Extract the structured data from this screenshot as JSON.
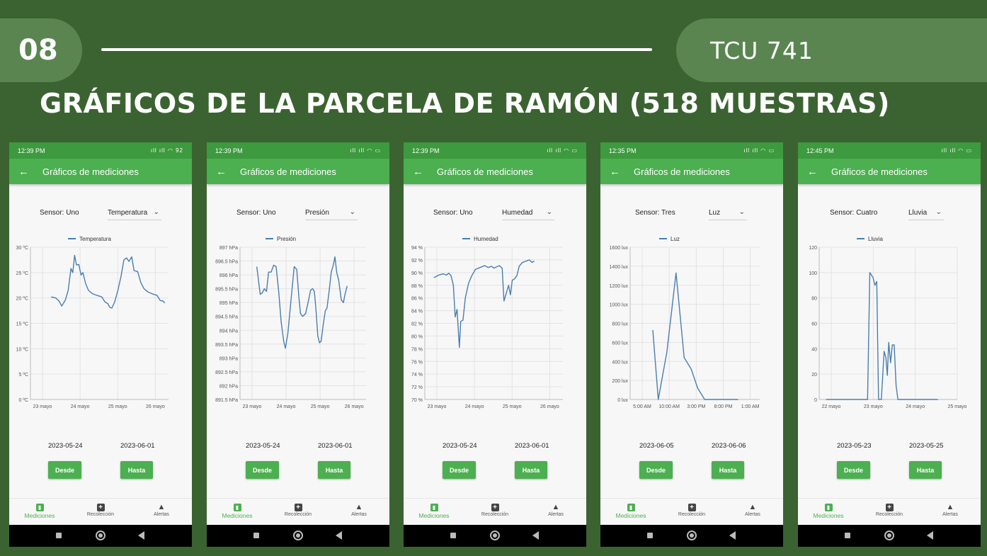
{
  "slide": {
    "number": "08",
    "course": "TCU 741",
    "title": "GRÁFICOS DE LA PARCELA DE RAMÓN (518 MUESTRAS)"
  },
  "colors": {
    "background": "#3b6331",
    "pill": "#5a8550",
    "app_green": "#4caf50",
    "status_green": "#3d9a3e",
    "line": "#4a7eb0"
  },
  "phones": [
    {
      "status_time": "12:39 PM",
      "status_icons": "ıll ıll ◠ 92",
      "app_title": "Gráficos de mediciones",
      "sensor_label": "Sensor: Uno",
      "selected": "Temperatura",
      "date_from": "2023-05-24",
      "date_to": "2023-06-01",
      "btn_from": "Desde",
      "btn_to": "Hasta",
      "nav": [
        "Mediciones",
        "Recolección",
        "Alertas"
      ],
      "chart_data": {
        "type": "line",
        "legend": "Temperatura",
        "y_unit": "°C",
        "y_ticks": [
          "0 ºC",
          "5 ºC",
          "10 ºC",
          "15 ºC",
          "20 ºC",
          "25 ºC",
          "30 ºC"
        ],
        "ylim": [
          0,
          30
        ],
        "x_ticks": [
          "23 mayo",
          "24 mayo",
          "25 mayo",
          "26 mayo"
        ],
        "xlim": [
          23.0,
          26.0
        ],
        "points": [
          [
            23.45,
            20.2
          ],
          [
            23.55,
            20.0
          ],
          [
            23.62,
            19.4
          ],
          [
            23.68,
            18.4
          ],
          [
            23.76,
            19.6
          ],
          [
            23.82,
            21.5
          ],
          [
            23.88,
            25.8
          ],
          [
            23.92,
            25.0
          ],
          [
            23.96,
            28.4
          ],
          [
            24.0,
            26.5
          ],
          [
            24.05,
            26.6
          ],
          [
            24.1,
            24.5
          ],
          [
            24.14,
            25.0
          ],
          [
            24.2,
            22.8
          ],
          [
            24.26,
            21.5
          ],
          [
            24.35,
            20.8
          ],
          [
            24.45,
            20.5
          ],
          [
            24.55,
            20.2
          ],
          [
            24.62,
            19.2
          ],
          [
            24.68,
            18.9
          ],
          [
            24.72,
            18.2
          ],
          [
            24.77,
            18.0
          ],
          [
            24.83,
            19.2
          ],
          [
            24.9,
            21.5
          ],
          [
            24.97,
            24.3
          ],
          [
            25.03,
            27.5
          ],
          [
            25.09,
            27.9
          ],
          [
            25.14,
            27.2
          ],
          [
            25.2,
            28.1
          ],
          [
            25.25,
            25.4
          ],
          [
            25.33,
            25.2
          ],
          [
            25.4,
            23.0
          ],
          [
            25.47,
            21.8
          ],
          [
            25.55,
            21.2
          ],
          [
            25.65,
            20.8
          ],
          [
            25.75,
            20.5
          ],
          [
            25.82,
            19.5
          ],
          [
            25.88,
            19.4
          ],
          [
            25.92,
            19.0
          ]
        ]
      }
    },
    {
      "status_time": "12:39 PM",
      "status_icons": "ıll ıll ◠ ▭",
      "app_title": "Gráficos de mediciones",
      "sensor_label": "Sensor: Uno",
      "selected": "Presión",
      "date_from": "2023-05-24",
      "date_to": "2023-06-01",
      "btn_from": "Desde",
      "btn_to": "Hasta",
      "nav": [
        "Mediciones",
        "Recolección",
        "Alertas"
      ],
      "chart_data": {
        "type": "line",
        "legend": "Presión",
        "y_unit": "hPa",
        "y_ticks": [
          "891.5 hPa",
          "892 hPa",
          "892.5 hPa",
          "893 hPa",
          "893.5 hPa",
          "894 hPa",
          "894.5 hPa",
          "895 hPa",
          "895.5 hPa",
          "896 hPa",
          "896.5 hPa",
          "897 hPa"
        ],
        "ylim": [
          891.5,
          897
        ],
        "x_ticks": [
          "23 mayo",
          "24 mayo",
          "25 mayo",
          "26 mayo"
        ],
        "xlim": [
          23.0,
          26.0
        ],
        "points": [
          [
            23.4,
            896.3
          ],
          [
            23.48,
            895.3
          ],
          [
            23.53,
            895.35
          ],
          [
            23.58,
            895.5
          ],
          [
            23.63,
            895.4
          ],
          [
            23.68,
            896.1
          ],
          [
            23.74,
            896.1
          ],
          [
            23.8,
            896.35
          ],
          [
            23.86,
            896.3
          ],
          [
            23.92,
            895.4
          ],
          [
            23.98,
            894.3
          ],
          [
            24.04,
            893.6
          ],
          [
            24.08,
            893.35
          ],
          [
            24.14,
            893.9
          ],
          [
            24.22,
            895.2
          ],
          [
            24.29,
            896.3
          ],
          [
            24.35,
            896.2
          ],
          [
            24.4,
            895.2
          ],
          [
            24.44,
            894.6
          ],
          [
            24.49,
            894.5
          ],
          [
            24.56,
            894.6
          ],
          [
            24.62,
            895.0
          ],
          [
            24.68,
            895.45
          ],
          [
            24.73,
            895.5
          ],
          [
            24.77,
            895.4
          ],
          [
            24.81,
            894.7
          ],
          [
            24.85,
            893.8
          ],
          [
            24.89,
            893.55
          ],
          [
            24.93,
            893.6
          ],
          [
            24.98,
            894.2
          ],
          [
            25.03,
            894.7
          ],
          [
            25.07,
            894.8
          ],
          [
            25.12,
            895.4
          ],
          [
            25.17,
            896.1
          ],
          [
            25.22,
            896.35
          ],
          [
            25.26,
            896.65
          ],
          [
            25.3,
            896.1
          ],
          [
            25.35,
            895.8
          ],
          [
            25.41,
            895.1
          ],
          [
            25.46,
            895.0
          ],
          [
            25.5,
            895.3
          ],
          [
            25.55,
            895.6
          ]
        ]
      }
    },
    {
      "status_time": "12:39 PM",
      "status_icons": "ıll ıll ◠ ▭",
      "app_title": "Gráficos de mediciones",
      "sensor_label": "Sensor: Uno",
      "selected": "Humedad",
      "date_from": "2023-05-24",
      "date_to": "2023-06-01",
      "btn_from": "Desde",
      "btn_to": "Hasta",
      "nav": [
        "Mediciones",
        "Recolección",
        "Alertas"
      ],
      "chart_data": {
        "type": "line",
        "legend": "Humedad",
        "y_unit": "%",
        "y_ticks": [
          "70 %",
          "72 %",
          "74 %",
          "76 %",
          "78 %",
          "80 %",
          "82 %",
          "84 %",
          "86 %",
          "88 %",
          "90 %",
          "92 %",
          "94 %"
        ],
        "ylim": [
          70,
          94
        ],
        "x_ticks": [
          "23 mayo",
          "24 mayo",
          "25 mayo",
          "26 mayo"
        ],
        "xlim": [
          23.0,
          26.0
        ],
        "points": [
          [
            23.2,
            89.2
          ],
          [
            23.3,
            89.6
          ],
          [
            23.4,
            89.8
          ],
          [
            23.47,
            89.6
          ],
          [
            23.52,
            89.9
          ],
          [
            23.57,
            89.5
          ],
          [
            23.62,
            88.0
          ],
          [
            23.66,
            83.0
          ],
          [
            23.7,
            84.2
          ],
          [
            23.75,
            78.2
          ],
          [
            23.78,
            82.3
          ],
          [
            23.83,
            82.5
          ],
          [
            23.88,
            86.0
          ],
          [
            23.95,
            88.3
          ],
          [
            24.02,
            89.5
          ],
          [
            24.1,
            90.5
          ],
          [
            24.2,
            90.8
          ],
          [
            24.3,
            91.1
          ],
          [
            24.38,
            90.8
          ],
          [
            24.45,
            91.0
          ],
          [
            24.5,
            90.7
          ],
          [
            24.56,
            90.9
          ],
          [
            24.62,
            91.1
          ],
          [
            24.68,
            90.7
          ],
          [
            24.72,
            85.5
          ],
          [
            24.78,
            87.0
          ],
          [
            24.82,
            88.0
          ],
          [
            24.86,
            86.5
          ],
          [
            24.9,
            88.8
          ],
          [
            24.95,
            89.0
          ],
          [
            25.0,
            89.5
          ],
          [
            25.05,
            91.0
          ],
          [
            25.12,
            91.6
          ],
          [
            25.2,
            91.8
          ],
          [
            25.27,
            92.0
          ],
          [
            25.33,
            91.6
          ],
          [
            25.38,
            91.8
          ]
        ]
      }
    },
    {
      "status_time": "12:35 PM",
      "status_icons": "ıll ıll ◠ ▭",
      "app_title": "Gráficos de mediciones",
      "sensor_label": "Sensor: Tres",
      "selected": "Luz",
      "date_from": "2023-06-05",
      "date_to": "2023-06-06",
      "btn_from": "Desde",
      "btn_to": "Hasta",
      "nav": [
        "Mediciones",
        "Recolección",
        "Alertas"
      ],
      "chart_data": {
        "type": "line",
        "legend": "Luz",
        "y_unit": "lux",
        "y_ticks": [
          "0 lux",
          "200 lux",
          "400 lux",
          "600 lux",
          "800 lux",
          "1000 lux",
          "1200 lux",
          "1400 lux",
          "1600 lux"
        ],
        "ylim": [
          0,
          1600
        ],
        "x_ticks": [
          "5:00 AM",
          "10:00 AM",
          "3:00 PM",
          "8:00 PM",
          "1:00 AM"
        ],
        "xlim": [
          5.0,
          29.0
        ],
        "points": [
          [
            9.2,
            730
          ],
          [
            10.2,
            0
          ],
          [
            11.8,
            500
          ],
          [
            13.5,
            1330
          ],
          [
            15.0,
            440
          ],
          [
            16.3,
            320
          ],
          [
            17.5,
            120
          ],
          [
            18.8,
            0
          ],
          [
            20.0,
            0
          ],
          [
            21.5,
            0
          ],
          [
            23.0,
            0
          ],
          [
            25.0,
            0
          ]
        ]
      }
    },
    {
      "status_time": "12:45 PM",
      "status_icons": "ıll ıll ◠ ▭",
      "app_title": "Gráficos de mediciones",
      "sensor_label": "Sensor: Cuatro",
      "selected": "Lluvia",
      "date_from": "2023-05-23",
      "date_to": "2023-05-25",
      "btn_from": "Desde",
      "btn_to": "Hasta",
      "nav": [
        "Mediciones",
        "Recolección",
        "Alertas"
      ],
      "chart_data": {
        "type": "line",
        "legend": "Lluvia",
        "y_unit": "",
        "y_ticks": [
          "0",
          "20",
          "40",
          "60",
          "80",
          "100",
          "120"
        ],
        "ylim": [
          0,
          120
        ],
        "x_ticks": [
          "22 mayo",
          "23 mayo",
          "24 mayo",
          "25 mayo"
        ],
        "xlim": [
          22.0,
          25.0
        ],
        "points": [
          [
            22.15,
            0
          ],
          [
            22.5,
            0
          ],
          [
            22.9,
            0
          ],
          [
            23.05,
            0
          ],
          [
            23.1,
            100
          ],
          [
            23.17,
            96
          ],
          [
            23.21,
            90
          ],
          [
            23.25,
            93
          ],
          [
            23.29,
            0
          ],
          [
            23.35,
            0
          ],
          [
            23.41,
            38
          ],
          [
            23.45,
            33
          ],
          [
            23.48,
            19
          ],
          [
            23.51,
            45
          ],
          [
            23.55,
            29
          ],
          [
            23.59,
            43
          ],
          [
            23.63,
            43
          ],
          [
            23.67,
            11
          ],
          [
            23.71,
            0
          ],
          [
            23.9,
            0
          ],
          [
            24.3,
            0
          ],
          [
            24.58,
            0
          ]
        ]
      }
    }
  ]
}
